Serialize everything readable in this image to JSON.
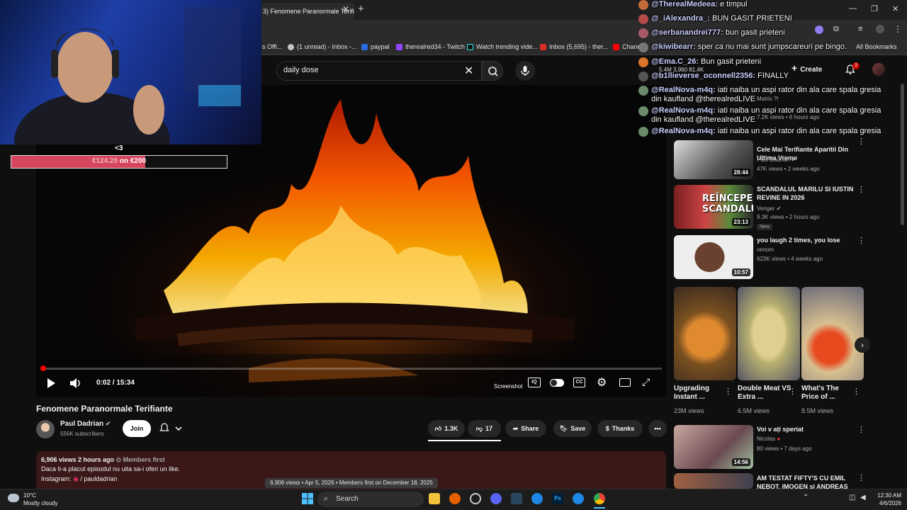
{
  "browser": {
    "tab_title": "3) Fenomene Paranormale Terifi",
    "bookmarks": [
      {
        "label": "s Offi...",
        "color": "#888888"
      },
      {
        "label": "(1 unread) - Inbox -...",
        "color": "#7b61ff"
      },
      {
        "label": "paypal",
        "color": "#2a6ae3"
      },
      {
        "label": "therealred34 - Twitch",
        "color": "#9146ff"
      },
      {
        "label": "Watch trending vide...",
        "color": "#25f4ee"
      },
      {
        "label": "Inbox (5,695) - ther...",
        "color": "#d93025"
      },
      {
        "label": "Chann",
        "color": "#ff0000"
      }
    ],
    "all_bookmarks": "All Bookmarks"
  },
  "youtube": {
    "search_value": "daily dose",
    "create_label": "Create",
    "notif_count": "3"
  },
  "stream": {
    "goal_heart": "<3",
    "goal_current": "€124.20",
    "goal_text": "on €200",
    "goal_fraction": 0.621
  },
  "player": {
    "time": "0:02 / 15:34",
    "screenshot_label": "Screenshot"
  },
  "video": {
    "title": "Fenomene Paranormale Terifiante",
    "channel": "Paul Dadrian",
    "subscribers": "556K subscribers",
    "join": "Join",
    "likes": "1.3K",
    "dislikes": "17",
    "share": "Share",
    "save": "Save",
    "thanks": "Thanks",
    "desc_meta": "6,906 views  2 hours ago",
    "desc_badge": "Members first",
    "desc_line1": "Daca ti-a placut episodul nu uita sa-i oferi un like.",
    "desc_line2_label": "Instagram:",
    "desc_line2_link": "/ pauldadrian",
    "tooltip": "6,906 views • Apr 5, 2026 • Members first on December 18, 2025"
  },
  "sidebar": {
    "videos": [
      {
        "title": "Cele Mai Terifiante Aparitii Din Ultima Vreme",
        "channel": "Paul Dadrian",
        "meta": "47K views • 2 weeks ago",
        "duration": "28:44"
      },
      {
        "title": "SCANDALUL MARILU SI IUSTIN REVINE IN 2026",
        "channel": "Venger",
        "meta": "9.3K views • 2 hours ago",
        "duration": "23:13",
        "badge": "New"
      },
      {
        "title": "you laugh 2 times, you lose",
        "channel": "venom",
        "meta": "623K views • 4 weeks ago",
        "duration": "10:57"
      }
    ],
    "shorts": [
      {
        "title": "Upgrading Instant ...",
        "views": "23M views"
      },
      {
        "title": "Double Meat VS Extra ...",
        "views": "6.5M views"
      },
      {
        "title": "What's The Price of ...",
        "views": "8.5M views"
      }
    ],
    "videos2": [
      {
        "title": "Voi v ați speriat",
        "channel": "Nicolas",
        "meta": "80 views • 7 days ago",
        "duration": "14:56"
      },
      {
        "title": "AM TESTAT FIFTY'S CU EMIL NEBOT, IMOGEN și ANDREAS",
        "channel": "",
        "meta": "",
        "duration": ""
      }
    ],
    "hidden_meta": "7.2K views • 6 hours ago",
    "hidden_new": "New",
    "partial_title": "Matrix ?!"
  },
  "chat": [
    {
      "user": "@TherealMedeea:",
      "msg": "e timpul",
      "color": "#c46b3a"
    },
    {
      "user": "@_iAlexandra_:",
      "msg": "BUN GASIT PRIETENI",
      "color": "#b44a4a"
    },
    {
      "user": "@serbanandrei777:",
      "msg": "bun gasit prieteni",
      "color": "#a85a6a"
    },
    {
      "user": "@kiwibearr:",
      "msg": "sper ca nu mai sunt jumpscareuri pe bingo.",
      "color": "#777777"
    },
    {
      "user": "@Ema.C_26:",
      "msg": "Bun gasit prieteni",
      "color": "#d9742b"
    },
    {
      "user": "@b1llieverse_oconnell2356:",
      "msg": "FINALLY",
      "color": "#555555"
    },
    {
      "user": "@RealNova-m4q:",
      "msg": "iati naiba un aspi rator din ala care spala gresia",
      "msg2": "din kaufland @therealredLIVE",
      "color": "#6a8a6a"
    },
    {
      "user": "@RealNova-m4q:",
      "msg": "iati naiba un aspi rator din ala care spala gresia",
      "msg2": "din kaufland @therealredLIVE",
      "color": "#6a8a6a"
    },
    {
      "user": "@RealNova-m4q:",
      "msg": "iati naiba un aspi rator din ala care spala gresia",
      "msg2": "din kaufland @therealredLIVE",
      "color": "#6a8a6a"
    }
  ],
  "channel_stats": {
    "a": "5.4M",
    "b": "3,960",
    "c": "81.4K"
  },
  "taskbar": {
    "temp": "10°C",
    "weather": "Mostly cloudy",
    "search": "Search",
    "time": "12:30 AM",
    "date": "4/6/2026"
  }
}
